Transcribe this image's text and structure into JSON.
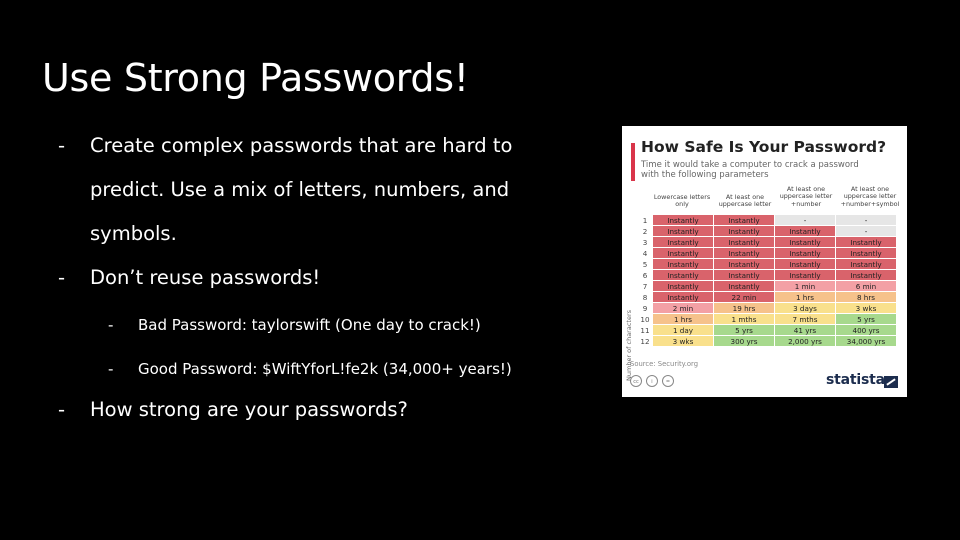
{
  "slide": {
    "title": "Use Strong Passwords!",
    "bullets": [
      "Create complex passwords that are hard to predict. Use a mix of letters, numbers, and symbols.",
      "Don’t reuse passwords!",
      "How strong are your passwords?"
    ],
    "sub_bullets": [
      "Bad Password: taylorswift (One day to crack!)",
      "Good Password: $WiftYforL!fe2k (34,000+ years!)"
    ],
    "dash": "-"
  },
  "chart": {
    "title": "How Safe Is Your Password?",
    "subtitle": "Time it would take a computer to crack a password with the following parameters",
    "column_headers": [
      "Lowercase letters only",
      "At least one uppercase letter",
      "At least one uppercase letter +number",
      "At least one uppercase letter +number+symbol"
    ],
    "y_label": "Number of characters",
    "rows": [
      {
        "n": "1",
        "cells": [
          "Instantly",
          "Instantly",
          "-",
          "-"
        ]
      },
      {
        "n": "2",
        "cells": [
          "Instantly",
          "Instantly",
          "Instantly",
          "-"
        ]
      },
      {
        "n": "3",
        "cells": [
          "Instantly",
          "Instantly",
          "Instantly",
          "Instantly"
        ]
      },
      {
        "n": "4",
        "cells": [
          "Instantly",
          "Instantly",
          "Instantly",
          "Instantly"
        ]
      },
      {
        "n": "5",
        "cells": [
          "Instantly",
          "Instantly",
          "Instantly",
          "Instantly"
        ]
      },
      {
        "n": "6",
        "cells": [
          "Instantly",
          "Instantly",
          "Instantly",
          "Instantly"
        ]
      },
      {
        "n": "7",
        "cells": [
          "Instantly",
          "Instantly",
          "1 min",
          "6 min"
        ]
      },
      {
        "n": "8",
        "cells": [
          "Instantly",
          "22 min",
          "1 hrs",
          "8 hrs"
        ]
      },
      {
        "n": "9",
        "cells": [
          "2 min",
          "19 hrs",
          "3 days",
          "3 wks"
        ]
      },
      {
        "n": "10",
        "cells": [
          "1 hrs",
          "1 mths",
          "7 mths",
          "5 yrs"
        ]
      },
      {
        "n": "11",
        "cells": [
          "1 day",
          "5 yrs",
          "41 yrs",
          "400 yrs"
        ]
      },
      {
        "n": "12",
        "cells": [
          "3 wks",
          "300 yrs",
          "2,000 yrs",
          "34,000 yrs"
        ]
      }
    ],
    "colors": {
      "instantly": "#d9636b",
      "minutes": "#f3a0a5",
      "dash": "#e6e6e6",
      "minutes_orange": "#f6c28b",
      "hours": "#f9e08c",
      "years": "#a7d98d",
      "accent": "#d9354a"
    },
    "source": "Source: Security.org",
    "license_icons": [
      "cc-icon",
      "by-icon",
      "nd-icon"
    ],
    "license_labels": [
      "cc",
      "i",
      "="
    ],
    "brand": "statista"
  }
}
